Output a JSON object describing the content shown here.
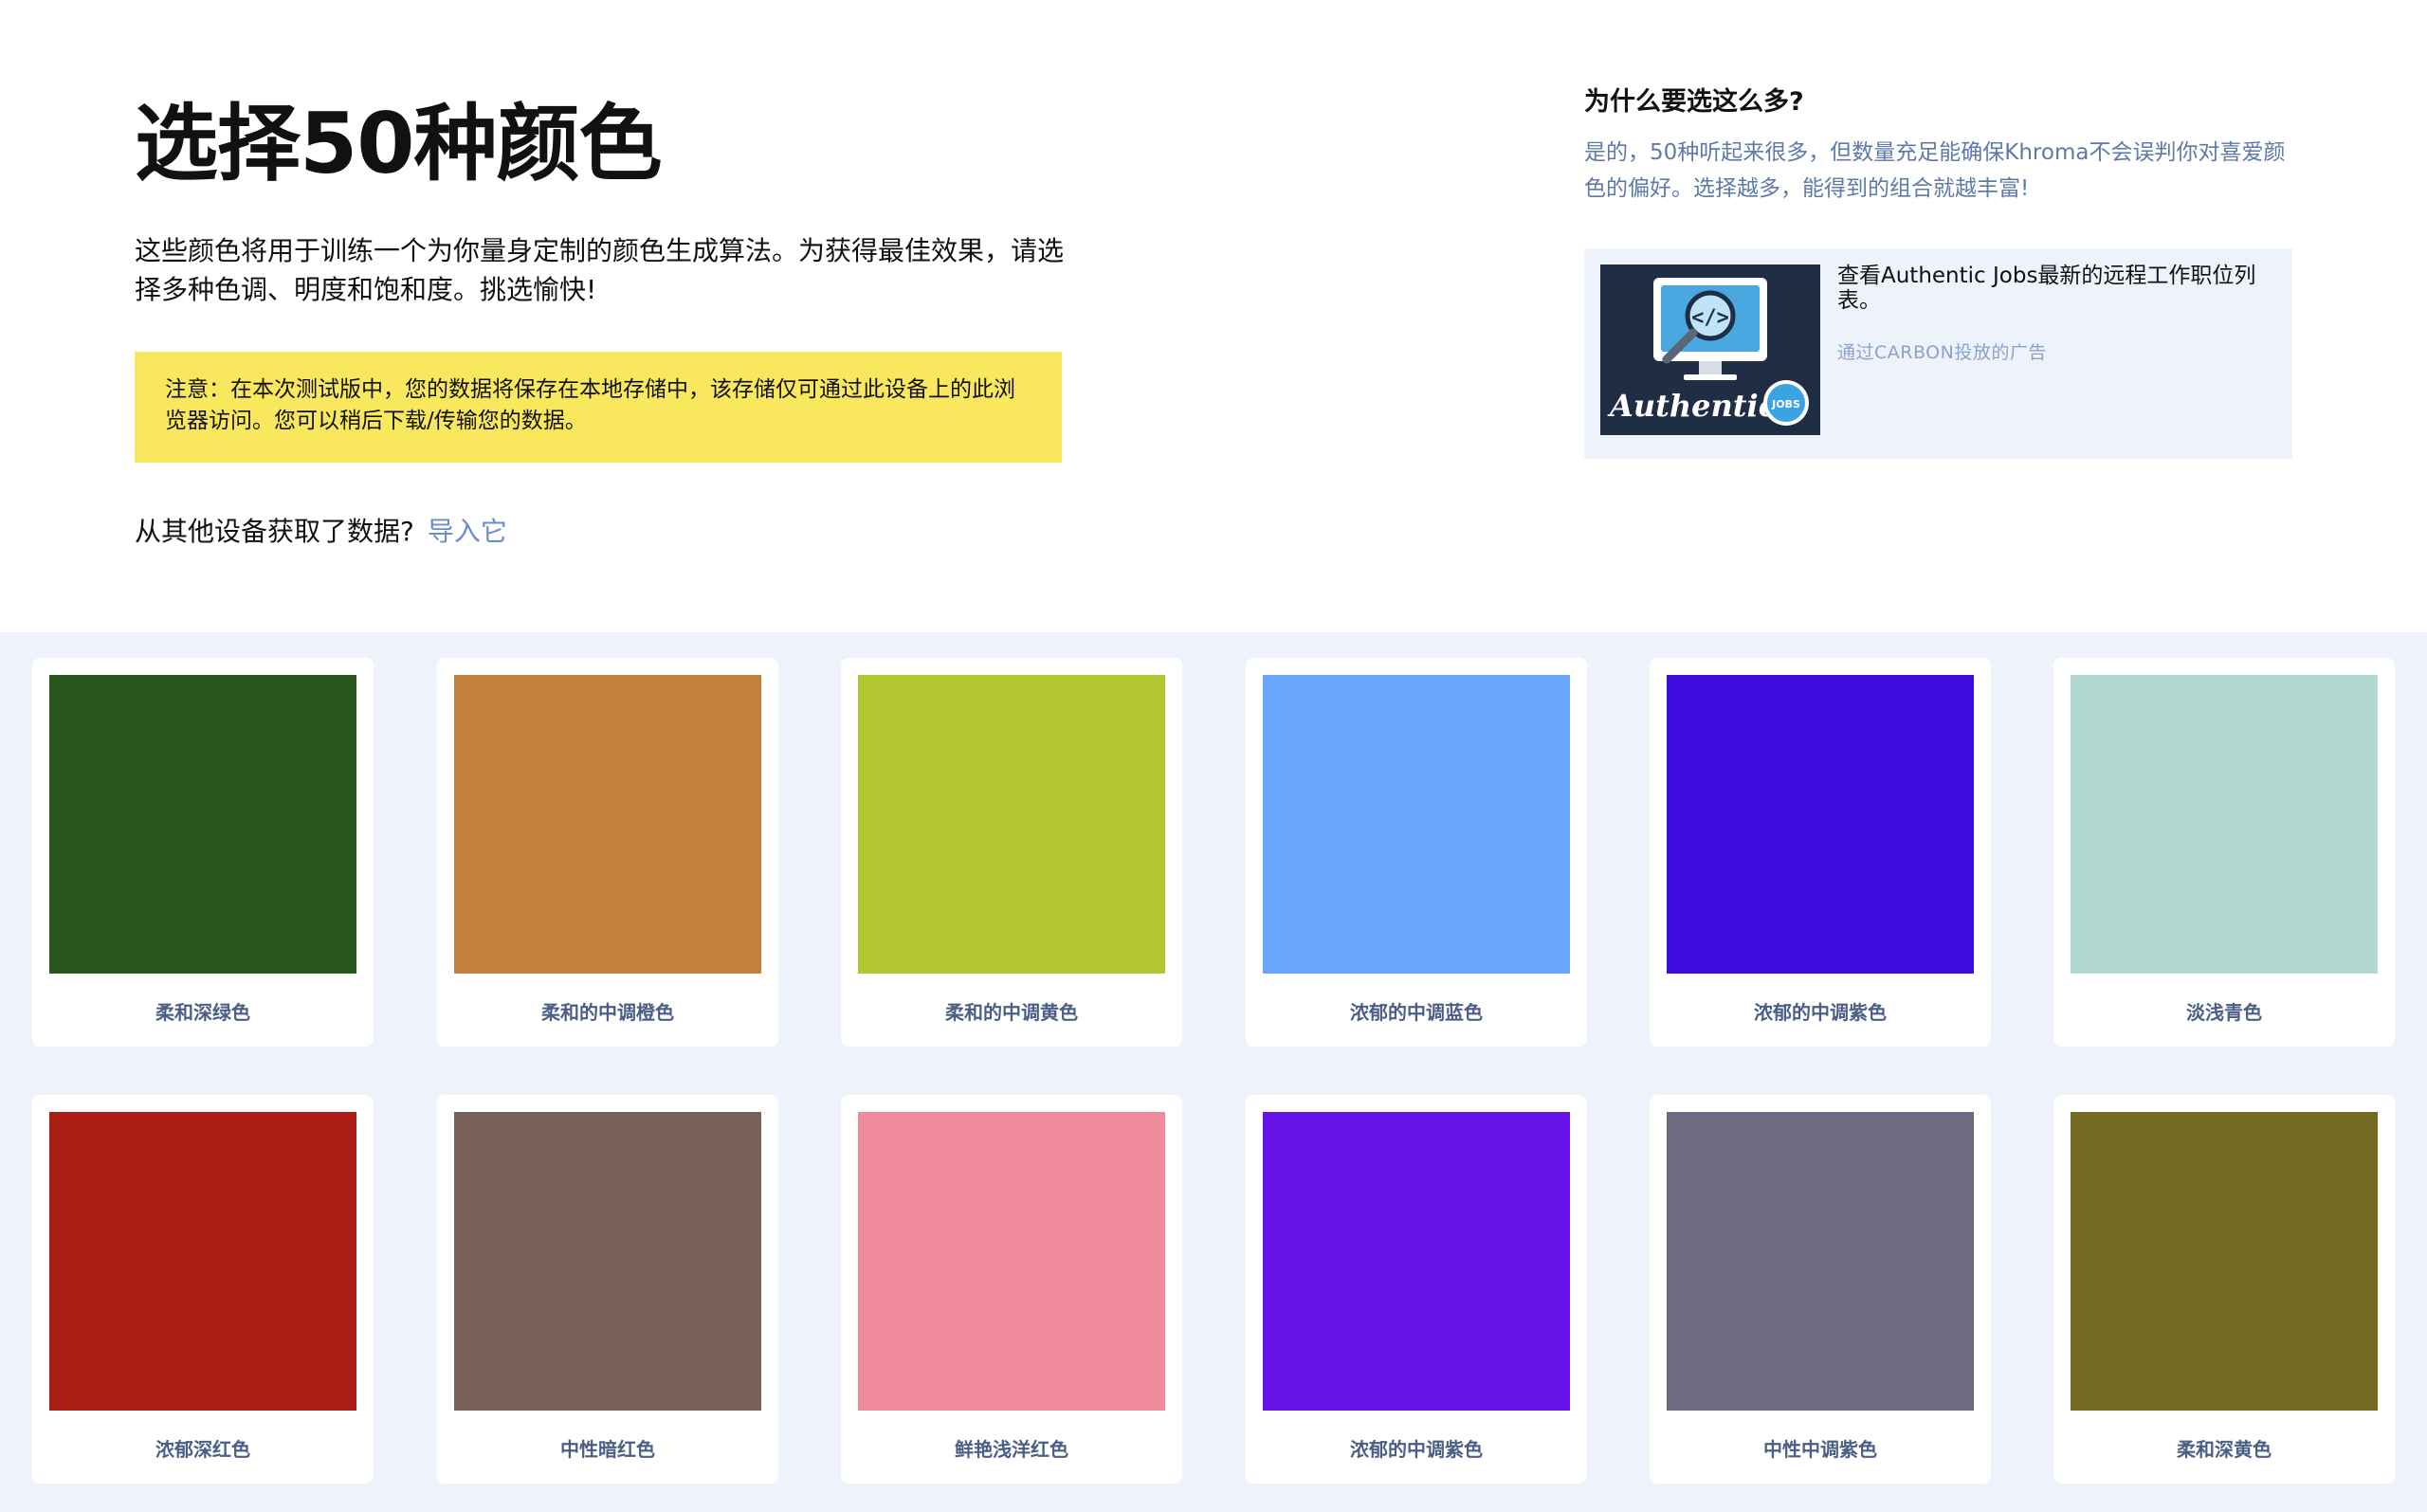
{
  "intro": {
    "title": "选择50种颜色",
    "subtitle": "这些颜色将用于训练一个为你量身定制的颜色生成算法。为获得最佳效果，请选择多种色调、明度和饱和度。挑选愉快!",
    "notice": "注意：在本次测试版中，您的数据将保存在本地存储中，该存储仅可通过此设备上的此浏览器访问。您可以稍后下载/传输您的数据。",
    "import_question": "从其他设备获取了数据?",
    "import_link": "导入它"
  },
  "side": {
    "why_title": "为什么要选这么多?",
    "why_text": "是的，50种听起来很多，但数量充足能确保Khroma不会误判你对喜爱颜色的偏好。选择越多，能得到的组合就越丰富!",
    "ad": {
      "logo_text": "Authentic",
      "badge_text": "JOBS",
      "text": "查看Authentic Jobs最新的远程工作职位列表。",
      "via": "通过CARBON投放的广告"
    }
  },
  "colors": [
    {
      "name": "柔和深绿色",
      "hex": "#27561b"
    },
    {
      "name": "柔和的中调橙色",
      "hex": "#c2803c"
    },
    {
      "name": "柔和的中调黄色",
      "hex": "#b3c730"
    },
    {
      "name": "浓郁的中调蓝色",
      "hex": "#69a6fb"
    },
    {
      "name": "浓郁的中调紫色",
      "hex": "#3e0bdd"
    },
    {
      "name": "淡浅青色",
      "hex": "#b2d9d1"
    },
    {
      "name": "浓郁深红色",
      "hex": "#aa1e15"
    },
    {
      "name": "中性暗红色",
      "hex": "#7a6157"
    },
    {
      "name": "鲜艳浅洋红色",
      "hex": "#ef8b9b"
    },
    {
      "name": "浓郁的中调紫色",
      "hex": "#6613ea"
    },
    {
      "name": "中性中调紫色",
      "hex": "#6f6a80"
    },
    {
      "name": "柔和深黄色",
      "hex": "#746a21"
    }
  ]
}
